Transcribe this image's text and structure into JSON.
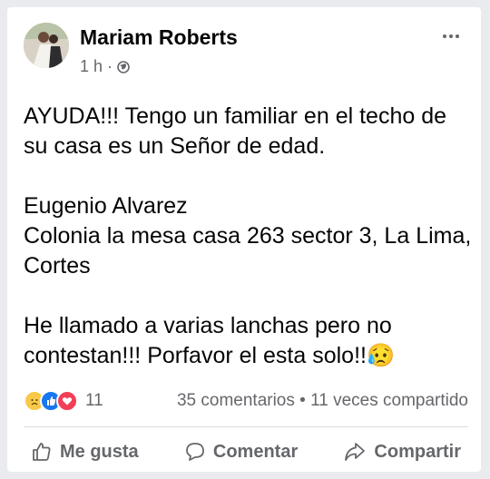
{
  "post": {
    "author": "Mariam Roberts",
    "time": "1 h",
    "separator": "·",
    "body_lines": [
      "AYUDA!!! Tengo un familiar en el techo de su casa es un Señor de edad.",
      "Eugenio Alvarez",
      "Colonia la mesa casa 263 sector 3, La Lima, Cortes",
      "He llamado a varias lanchas pero no contestan!!! Porfavor el esta solo!!"
    ],
    "emoji": "😥"
  },
  "stats": {
    "reaction_count": "11",
    "comments": "35 comentarios",
    "dot": "•",
    "shares": "11 veces compartido",
    "reaction_icons": [
      "sad-face",
      "like",
      "love"
    ]
  },
  "actions": {
    "like": "Me gusta",
    "comment": "Comentar",
    "share": "Compartir"
  },
  "colors": {
    "background": "#e9ebee",
    "card": "#ffffff",
    "text": "#050505",
    "secondary": "#65676b",
    "like_blue": "#1877f2",
    "love_red": "#f33e58"
  }
}
